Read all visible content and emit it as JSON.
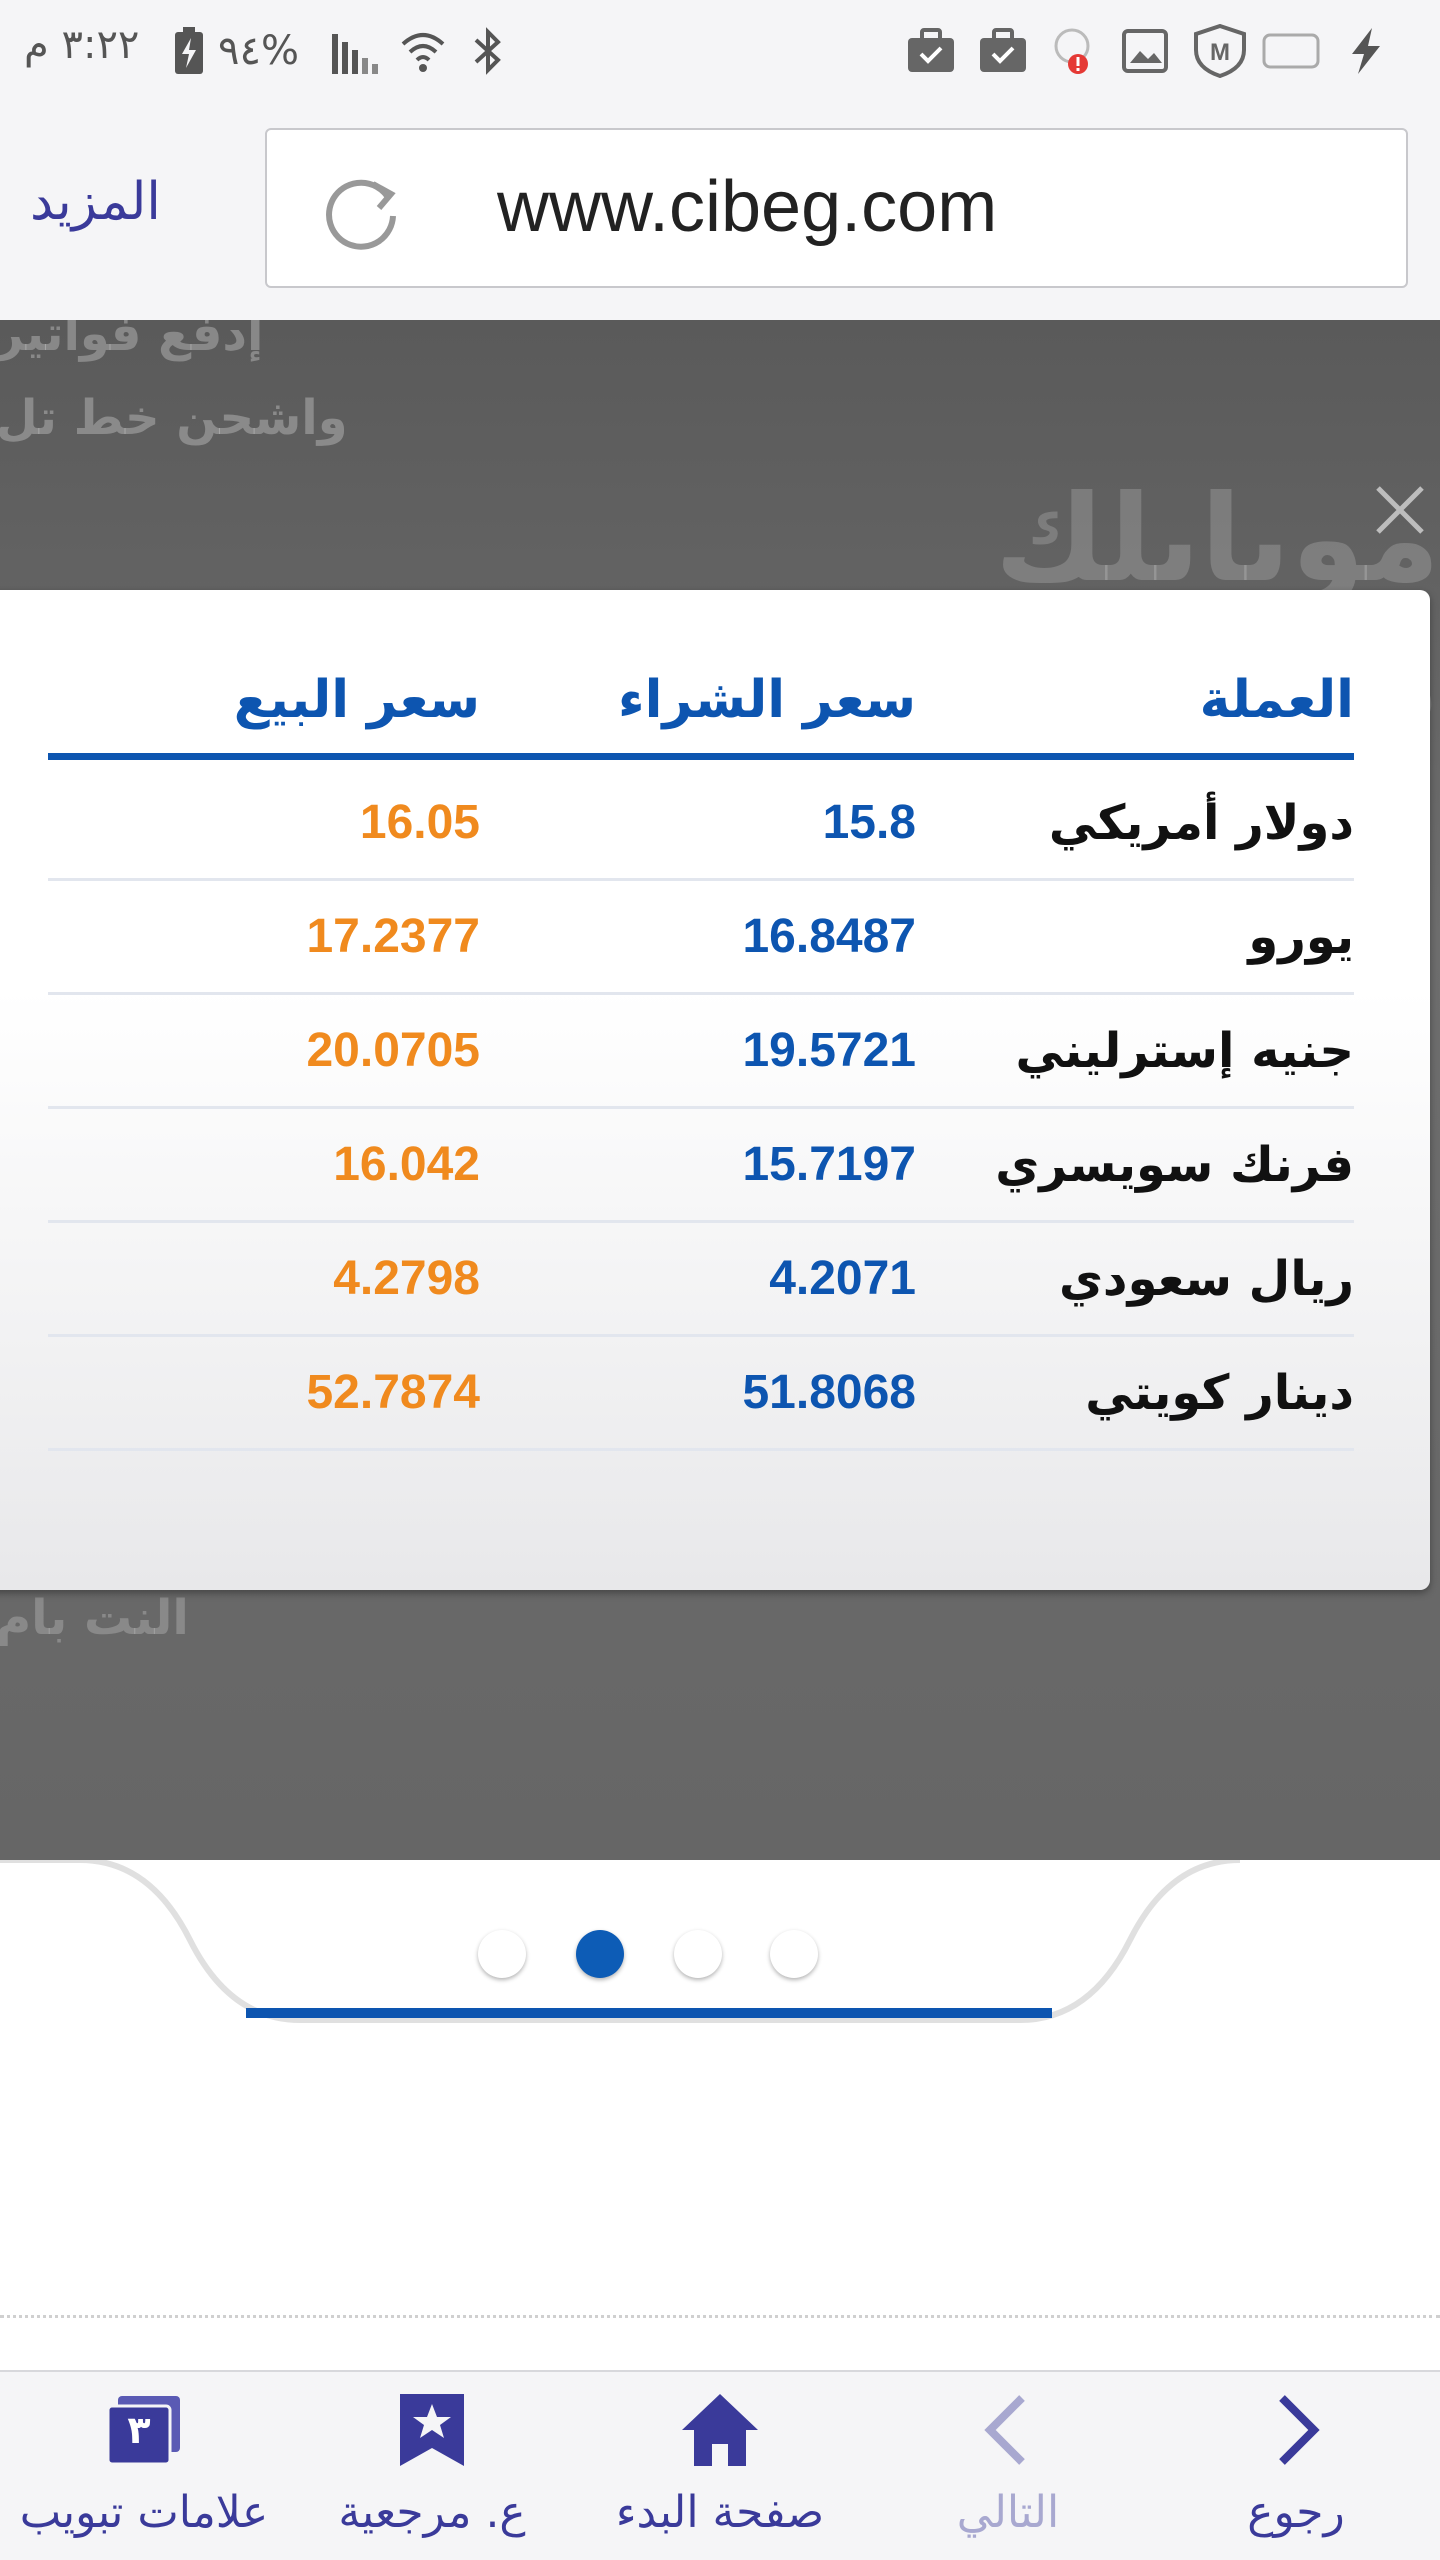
{
  "status_bar": {
    "time": "٣:٢٢ م",
    "battery": "%٩٤"
  },
  "browser": {
    "url": "www.cibeg.com",
    "more_label": "المزيد"
  },
  "banner": {
    "ghost_lines": [
      "إدفع فواتير",
      "واشحن خط تل",
      "موبايلك محفظتك",
      "النت بام"
    ]
  },
  "rates_table": {
    "headers": {
      "currency": "العملة",
      "buy": "سعر الشراء",
      "sell": "سعر البيع"
    },
    "rows": [
      {
        "currency": "دولار أمريكي",
        "buy": "15.8",
        "sell": "16.05"
      },
      {
        "currency": "يورو",
        "buy": "16.8487",
        "sell": "17.2377"
      },
      {
        "currency": "جنيه إسترليني",
        "buy": "19.5721",
        "sell": "20.0705"
      },
      {
        "currency": "فرنك سويسري",
        "buy": "15.7197",
        "sell": "16.042"
      },
      {
        "currency": "ريال سعودي",
        "buy": "4.2071",
        "sell": "4.2798"
      },
      {
        "currency": "دينار كويتي",
        "buy": "51.8068",
        "sell": "52.7874"
      }
    ]
  },
  "slider": {
    "dot_count": 4,
    "active_index": 1
  },
  "bottom_nav": {
    "back": "رجوع",
    "forward": "التالي",
    "home": "صفحة البدء",
    "bookmarks": "ع. مرجعية",
    "tabs": "علامات تبويب",
    "tabs_count": "٣"
  },
  "colors": {
    "accent_blue": "#0d55b0",
    "sell_orange": "#f08a1e",
    "nav_purple": "#3a3a9a"
  }
}
